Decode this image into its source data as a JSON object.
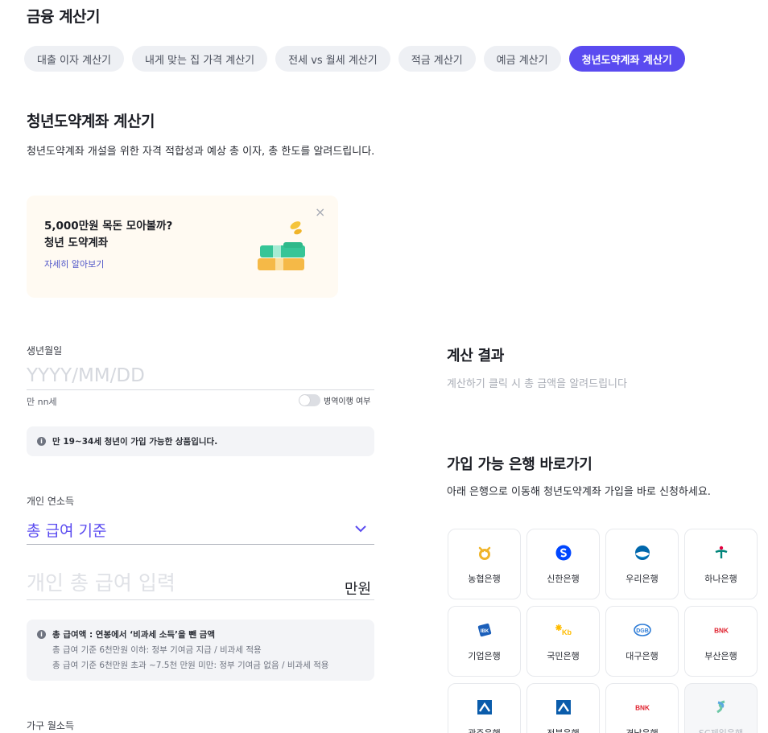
{
  "header": {
    "title": "금융 계산기"
  },
  "tabs": [
    {
      "label": "대출 이자 계산기",
      "active": false
    },
    {
      "label": "내게 맞는 집 가격 계산기",
      "active": false
    },
    {
      "label": "전세 vs 월세 계산기",
      "active": false
    },
    {
      "label": "적금 계산기",
      "active": false
    },
    {
      "label": "예금 계산기",
      "active": false
    },
    {
      "label": "청년도약계좌 계산기",
      "active": true
    }
  ],
  "section": {
    "title": "청년도약계좌 계산기",
    "description": "청년도약계좌 개설을 위한 자격 적합성과 예상 총 이자, 총 한도를 알려드립니다."
  },
  "promo": {
    "line1": "5,000만원 목돈 모아볼까?",
    "line2": "청년 도약계좌",
    "link": "자세히 알아보기",
    "close": "×"
  },
  "birth": {
    "label": "생년월일",
    "placeholder": "YYYY/MM/DD",
    "value": "",
    "age": "만 nn세",
    "toggle_label": "병역이행 여부",
    "toggle_on": false
  },
  "age_notice": {
    "text": "만 19~34세 청년이 가입 가능한 상품입니다."
  },
  "income": {
    "label": "개인 연소득",
    "select_value": "총 급여 기준",
    "input_placeholder": "개인 총 급여 입력",
    "input_value": "",
    "unit": "만원"
  },
  "income_notice": {
    "title": "총 급여액 : 연봉에서 ‘비과세 소득’을 뺀 금액",
    "line1": "총 급여 기준 6천만원 이하: 정부 기여금 지급 / 비과세 적용",
    "line2": "총 급여 기준 6천만원 초과 ~7.5천 만원 미만: 정부 기여금 없음 / 비과세 적용"
  },
  "household": {
    "label": "가구 월소득"
  },
  "result": {
    "title": "계산 결과",
    "description": "계산하기 클릭 시 총 금액을 알려드립니다"
  },
  "banks": {
    "title": "가입 가능 은행 바로가기",
    "description": "아래 은행으로 이동해 청년도약계좌 가입을 바로 신청하세요.",
    "items": [
      {
        "name": "농협은행",
        "icon": "nh-bank-icon"
      },
      {
        "name": "신한은행",
        "icon": "shinhan-bank-icon"
      },
      {
        "name": "우리은행",
        "icon": "woori-bank-icon"
      },
      {
        "name": "하나은행",
        "icon": "hana-bank-icon"
      },
      {
        "name": "기업은행",
        "icon": "ibk-bank-icon"
      },
      {
        "name": "국민은행",
        "icon": "kb-bank-icon"
      },
      {
        "name": "대구은행",
        "icon": "dgb-bank-icon"
      },
      {
        "name": "부산은행",
        "icon": "bnk-busan-bank-icon"
      },
      {
        "name": "광주은행",
        "icon": "kwangju-bank-icon"
      },
      {
        "name": "전북은행",
        "icon": "jeonbuk-bank-icon"
      },
      {
        "name": "경남은행",
        "icon": "bnk-kyongnam-bank-icon"
      },
      {
        "name": "SC제일은행",
        "icon": "sc-bank-icon"
      }
    ]
  },
  "colors": {
    "accent": "#5a4bf0",
    "tab_bg": "#eef0f4",
    "promo_bg": "#fffaf2",
    "info_bg": "#f3f4f7"
  }
}
